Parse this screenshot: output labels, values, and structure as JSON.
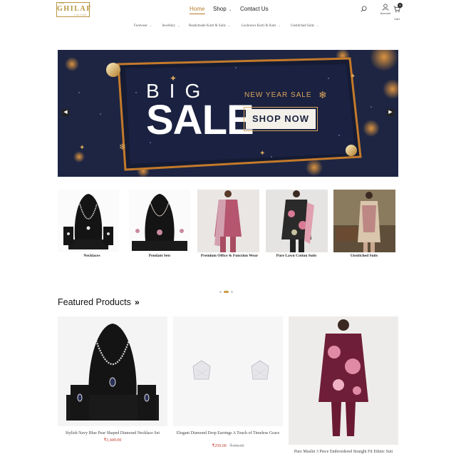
{
  "brand": {
    "small": "THE",
    "name": "GHILAF",
    "tag": "COUTURE"
  },
  "nav": {
    "home": "Home",
    "shop": "Shop",
    "contact": "Contact Us"
  },
  "account": {
    "label": "Account"
  },
  "cart": {
    "label": "Cart",
    "count": "0"
  },
  "categories_nav": [
    "Footwear",
    "Jewellery",
    "Readymade Kurti & Suits",
    "Lucknowi Kurti & Suits",
    "Unstitched Suits"
  ],
  "hero": {
    "big": "BIG",
    "sale": "SALE",
    "subtitle": "NEW YEAR SALE",
    "cta": "SHOP NOW"
  },
  "categories": [
    {
      "label": "Necklaces"
    },
    {
      "label": "Pendant Sets"
    },
    {
      "label": "Premium Office & Function Wear"
    },
    {
      "label": "Pure Lawn Cotton Suits"
    },
    {
      "label": "Unstitched Suits"
    }
  ],
  "featured": {
    "title": "Featured Products",
    "products": [
      {
        "name": "Stylish Navy Blue Pear Shaped Diamond Necklace Set",
        "price": "₹3,449.00",
        "old_price": ""
      },
      {
        "name": "Elegant Diamond Drop Earrings A Touch of Timeless Grace",
        "price": "₹250.00",
        "old_price": "₹400.00"
      },
      {
        "name": "Pure Muslin 3 Piece Embroidered Straight Fit Ethnic Suit",
        "price": "",
        "old_price": ""
      }
    ]
  },
  "colors": {
    "accent": "#b47a2a",
    "gold": "#d8a55c",
    "hero_bg": "#1c2440",
    "price": "#c0392b"
  }
}
